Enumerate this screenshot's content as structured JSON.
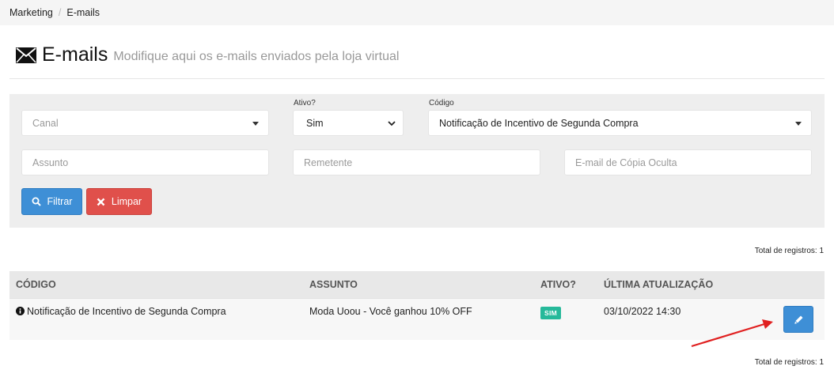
{
  "breadcrumb": {
    "items": [
      "Marketing",
      "E-mails"
    ]
  },
  "header": {
    "title": "E-mails",
    "subtitle": "Modifique aqui os e-mails enviados pela loja virtual"
  },
  "filters": {
    "canal": {
      "placeholder": "Canal"
    },
    "ativo": {
      "label": "Ativo?",
      "value": "Sim"
    },
    "codigo": {
      "label": "Código",
      "value": "Notificação de Incentivo de Segunda Compra"
    },
    "assunto": {
      "placeholder": "Assunto"
    },
    "remetente": {
      "placeholder": "Remetente"
    },
    "bcc": {
      "placeholder": "E-mail de Cópia Oculta"
    },
    "filter_button": "Filtrar",
    "clear_button": "Limpar"
  },
  "total_top": "Total de registros: 1",
  "total_bottom": "Total de registros: 1",
  "table": {
    "headers": [
      "CÓDIGO",
      "ASSUNTO",
      "ATIVO?",
      "ÚLTIMA ATUALIZAÇÃO"
    ],
    "rows": [
      {
        "codigo": "Notificação de Incentivo de Segunda Compra",
        "assunto": "Moda Uoou - Você ganhou 10% OFF",
        "ativo": "SIM",
        "atualizacao": "03/10/2022 14:30"
      }
    ]
  },
  "colors": {
    "primary": "#3e8fd6",
    "danger": "#e0504b",
    "success": "#26b99a",
    "annotation": "#e02020"
  }
}
